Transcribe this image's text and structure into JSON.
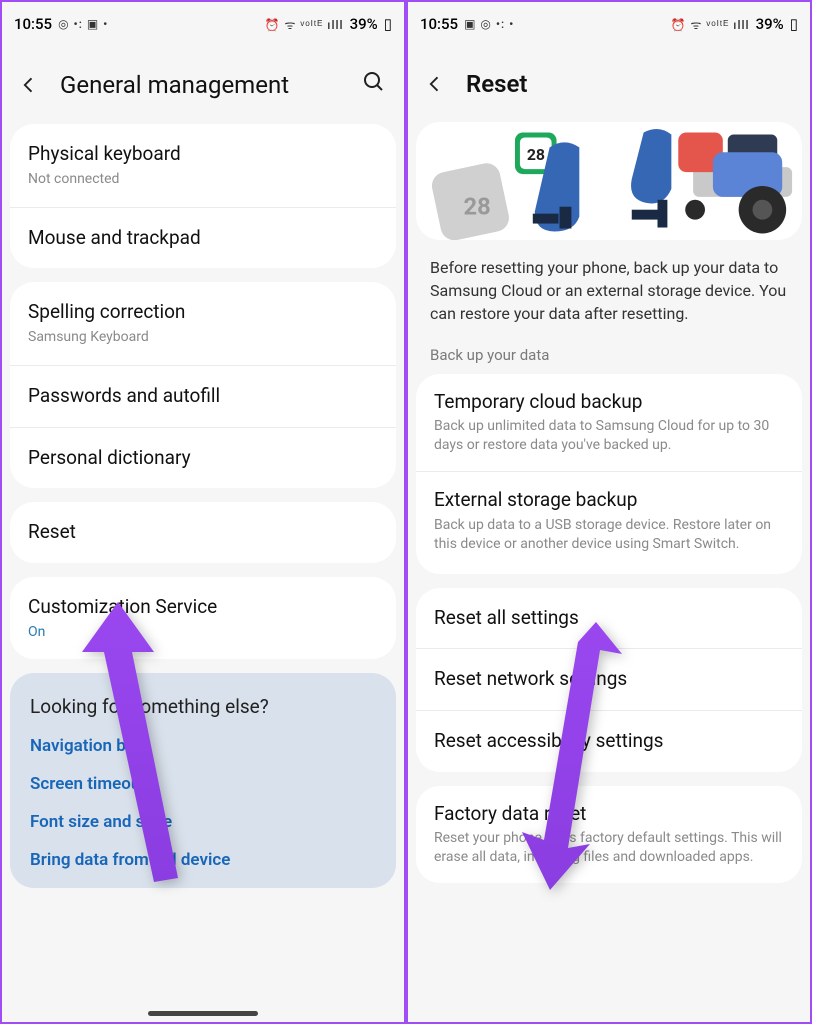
{
  "status": {
    "time": "10:55",
    "battery": "39%"
  },
  "left": {
    "title": "General management",
    "items1": [
      {
        "title": "Physical keyboard",
        "sub": "Not connected"
      },
      {
        "title": "Mouse and trackpad"
      }
    ],
    "items2": [
      {
        "title": "Spelling correction",
        "sub": "Samsung Keyboard"
      },
      {
        "title": "Passwords and autofill"
      },
      {
        "title": "Personal dictionary"
      }
    ],
    "items3": [
      {
        "title": "Reset"
      }
    ],
    "items4": [
      {
        "title": "Customization Service",
        "sub": "On",
        "blue": true
      }
    ],
    "suggestions": {
      "heading": "Looking for something else?",
      "links": [
        "Navigation bar",
        "Screen timeout",
        "Font size and style",
        "Bring data from old device"
      ]
    }
  },
  "right": {
    "title": "Reset",
    "info": "Before resetting your phone, back up your data to Samsung Cloud or an external storage device. You can restore your data after resetting.",
    "backup_label": "Back up your data",
    "backup_items": [
      {
        "title": "Temporary cloud backup",
        "sub": "Back up unlimited data to Samsung Cloud for up to 30 days or restore data you've backed up."
      },
      {
        "title": "External storage backup",
        "sub": "Back up data to a USB storage device. Restore later on this device or another device using Smart Switch."
      }
    ],
    "reset_items": [
      {
        "title": "Reset all settings"
      },
      {
        "title": "Reset network settings"
      },
      {
        "title": "Reset accessibility settings"
      }
    ],
    "factory": [
      {
        "title": "Factory data reset",
        "sub": "Reset your phone to its factory default settings. This will erase all data, including files and downloaded apps."
      }
    ]
  }
}
